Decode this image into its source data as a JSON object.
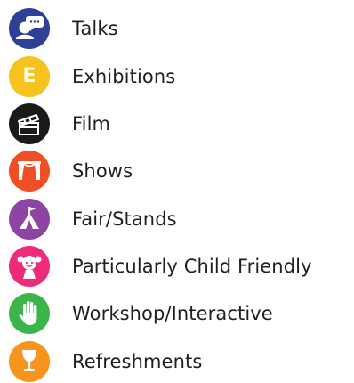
{
  "legend": {
    "items": [
      {
        "label": "Talks",
        "icon": "speaker-bubble-icon",
        "color": "#2e3f96"
      },
      {
        "label": "Exhibitions",
        "icon": "letter-e-icon",
        "letter": "E",
        "color": "#f6c21c"
      },
      {
        "label": "Film",
        "icon": "clapperboard-icon",
        "color": "#1a1a1a"
      },
      {
        "label": "Shows",
        "icon": "stage-curtain-icon",
        "color": "#f04e24"
      },
      {
        "label": "Fair/Stands",
        "icon": "tent-flag-icon",
        "color": "#8e44a4"
      },
      {
        "label": "Particularly Child Friendly",
        "icon": "child-girl-icon",
        "color": "#ee2b7b"
      },
      {
        "label": "Workshop/Interactive",
        "icon": "raised-hand-icon",
        "color": "#3bb54a"
      },
      {
        "label": "Refreshments",
        "icon": "wine-glass-icon",
        "color": "#f7941d"
      }
    ]
  }
}
